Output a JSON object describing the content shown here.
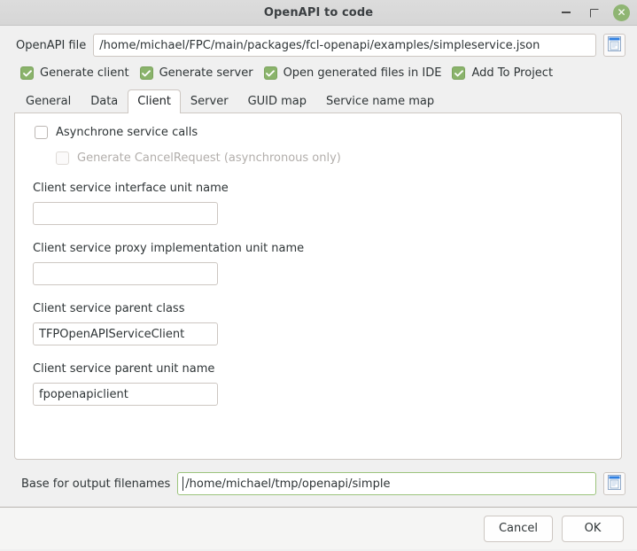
{
  "window": {
    "title": "OpenAPI to code",
    "controls": {
      "minimize": "minimize-icon",
      "maximize": "maximize-icon",
      "close": "✕"
    }
  },
  "top_row": {
    "label": "OpenAPI file",
    "value": "/home/michael/FPC/main/packages/fcl-openapi/examples/simpleservice.json",
    "browse_icon": "file-browse-icon"
  },
  "options": [
    {
      "label": "Generate client",
      "checked": true
    },
    {
      "label": "Generate server",
      "checked": true
    },
    {
      "label": "Open generated files in IDE",
      "checked": true
    },
    {
      "label": "Add To Project",
      "checked": true
    }
  ],
  "tabs": [
    {
      "label": "General",
      "active": false
    },
    {
      "label": "Data",
      "active": false
    },
    {
      "label": "Client",
      "active": true
    },
    {
      "label": "Server",
      "active": false
    },
    {
      "label": "GUID map",
      "active": false
    },
    {
      "label": "Service name map",
      "active": false
    }
  ],
  "client_panel": {
    "async_checkbox": {
      "label": "Asynchrone service calls",
      "checked": false,
      "disabled": false
    },
    "cancel_request_checkbox": {
      "label": "Generate CancelRequest (asynchronous only)",
      "checked": false,
      "disabled": true
    },
    "fields": [
      {
        "label": "Client service interface unit name",
        "value": ""
      },
      {
        "label": "Client service proxy implementation unit name",
        "value": ""
      },
      {
        "label": "Client service parent class",
        "value": "TFPOpenAPIServiceClient"
      },
      {
        "label": "Client service parent unit name",
        "value": "fpopenapiclient"
      }
    ]
  },
  "base_row": {
    "label": "Base for output filenames",
    "value": "/home/michael/tmp/openapi/simple",
    "browse_icon": "file-browse-icon"
  },
  "buttons": {
    "cancel": "Cancel",
    "ok": "OK"
  },
  "colors": {
    "accent_green": "#8ab36b",
    "focus_green": "#9cc47c",
    "window_bg": "#f0f0f0",
    "panel_bg": "#ffffff"
  }
}
